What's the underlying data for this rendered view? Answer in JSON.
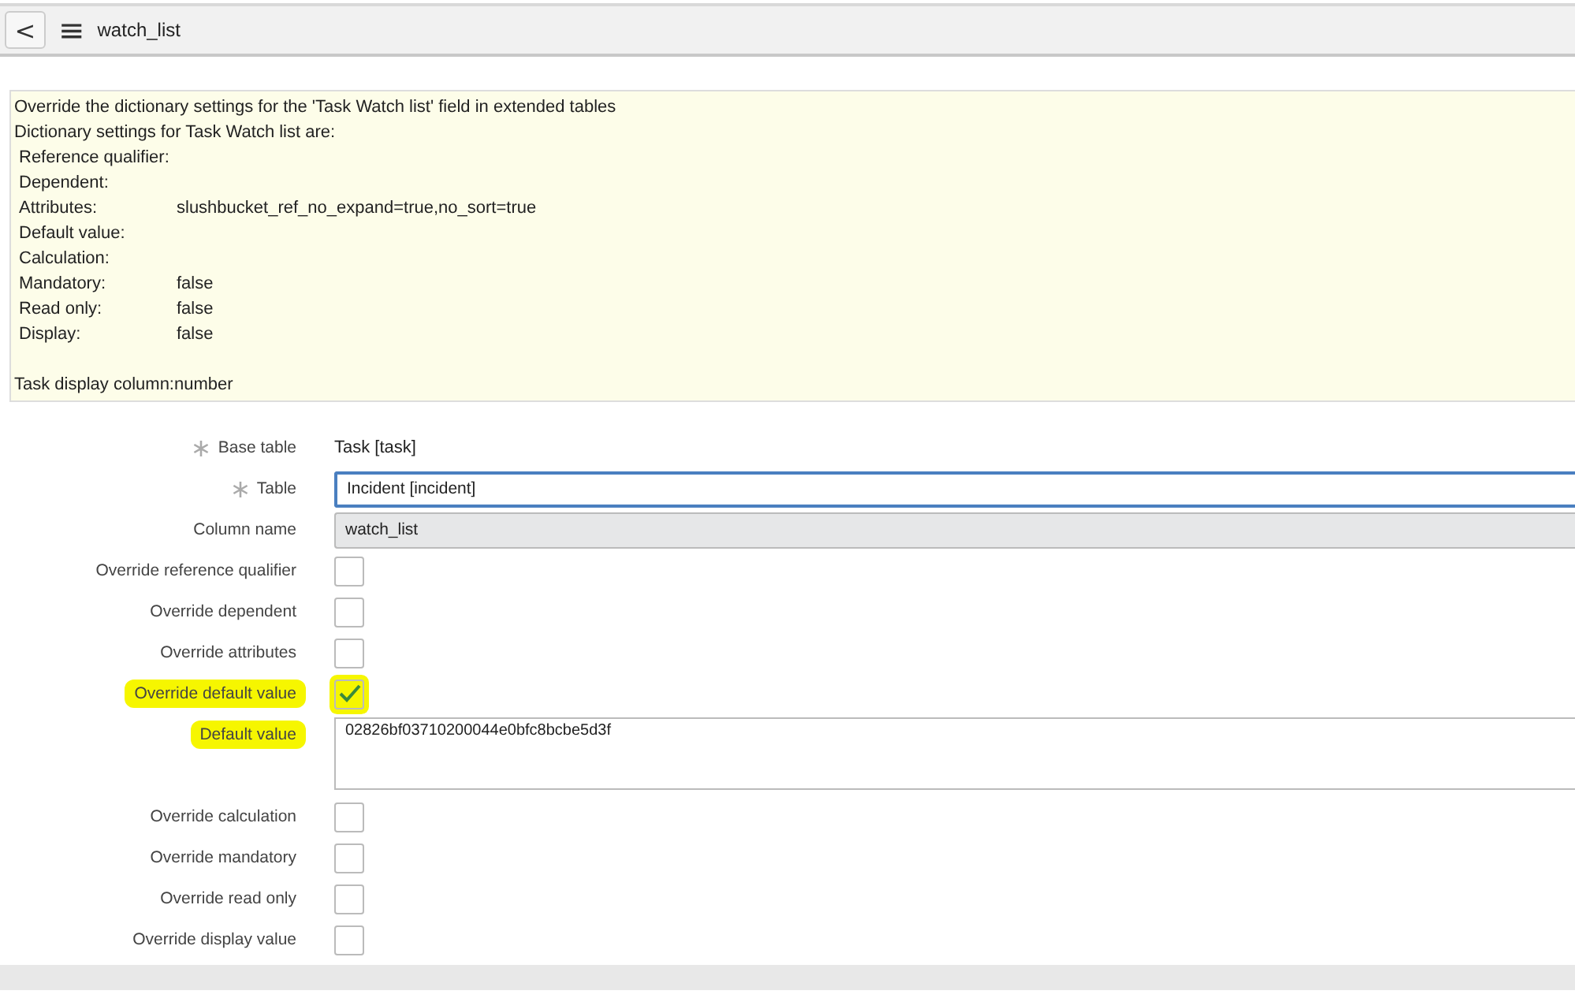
{
  "header": {
    "back": "<",
    "menu": "≡",
    "title": "watch_list"
  },
  "info": {
    "heading": "Override the dictionary settings for the 'Task Watch list' field in extended tables",
    "subheading": "Dictionary settings for Task Watch list are:",
    "settings": [
      {
        "label": "Reference qualifier:"
      },
      {
        "label": "Dependent:"
      },
      {
        "label": "Attributes:",
        "value": "slushbucket_ref_no_expand=true,no_sort=true"
      },
      {
        "label": "Default value:"
      },
      {
        "label": "Calculation:"
      },
      {
        "label": "Mandatory:",
        "value": "false"
      },
      {
        "label": "Read only:",
        "value": "false"
      },
      {
        "label": "Display:",
        "value": "false"
      }
    ],
    "footer": "Task display column:number"
  },
  "fields": [
    {
      "kind": "text",
      "label": "Base table",
      "mandatory": true,
      "highlighted": false,
      "value": "Task [task]"
    },
    {
      "kind": "input",
      "label": "Table",
      "mandatory": true,
      "highlighted": false,
      "value": "Incident [incident]",
      "focused": true
    },
    {
      "kind": "readonly",
      "label": "Column name",
      "mandatory": false,
      "highlighted": false,
      "value": "watch_list"
    },
    {
      "kind": "checkbox",
      "label": "Override reference qualifier",
      "mandatory": false,
      "highlighted": false,
      "checked": false
    },
    {
      "kind": "checkbox",
      "label": "Override dependent",
      "mandatory": false,
      "highlighted": false,
      "checked": false
    },
    {
      "kind": "checkbox",
      "label": "Override attributes",
      "mandatory": false,
      "highlighted": false,
      "checked": false
    },
    {
      "kind": "checkbox",
      "label": "Override default value",
      "mandatory": false,
      "highlighted": true,
      "checked": true
    },
    {
      "kind": "textarea",
      "label": "Default value",
      "mandatory": false,
      "highlighted": true,
      "value": "02826bf03710200044e0bfc8bcbe5d3f"
    },
    {
      "kind": "checkbox",
      "label": "Override calculation",
      "mandatory": false,
      "highlighted": false,
      "checked": false
    },
    {
      "kind": "checkbox",
      "label": "Override mandatory",
      "mandatory": false,
      "highlighted": false,
      "checked": false
    },
    {
      "kind": "checkbox",
      "label": "Override read only",
      "mandatory": false,
      "highlighted": false,
      "checked": false
    },
    {
      "kind": "checkbox",
      "label": "Override display value",
      "mandatory": false,
      "highlighted": false,
      "checked": false
    }
  ]
}
